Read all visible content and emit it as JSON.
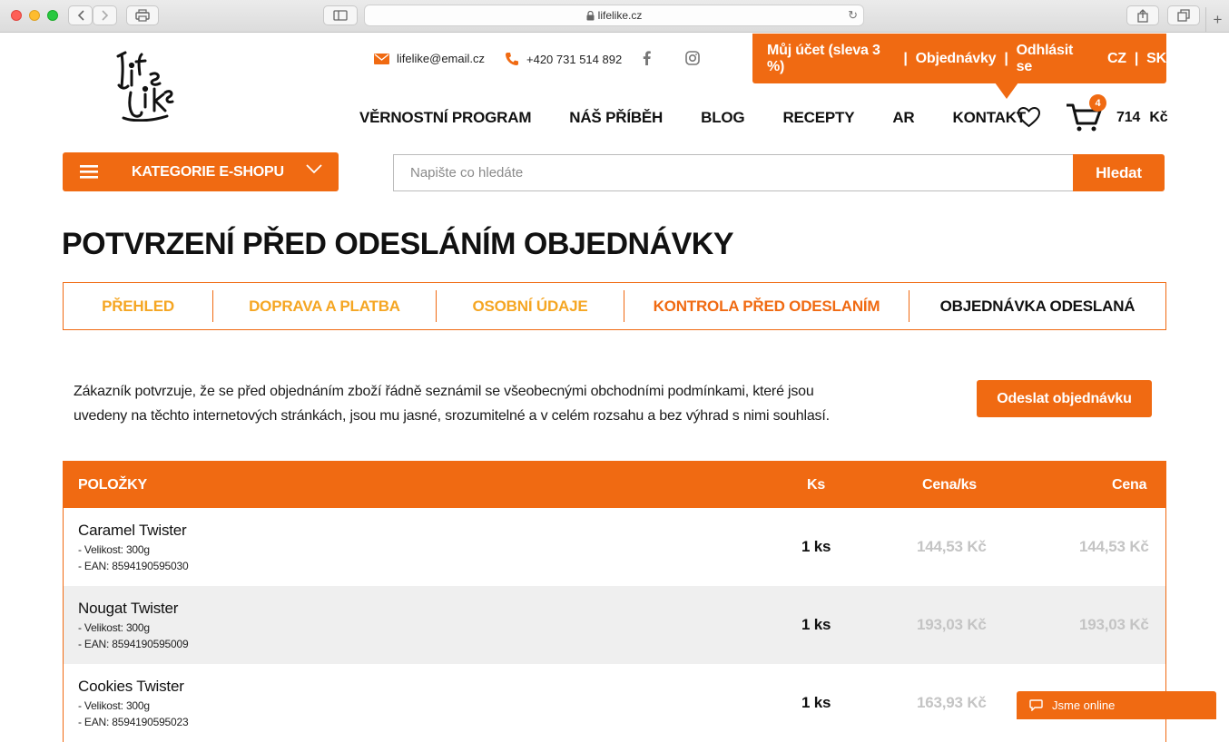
{
  "browser": {
    "url": "lifelike.cz"
  },
  "header": {
    "logo_text": "LiFeLiKe",
    "email": "lifelike@email.cz",
    "phone": "+420 731 514 892",
    "account": {
      "my_account": "Můj účet (sleva 3 %)",
      "orders": "Objednávky",
      "logout": "Odhlásit se",
      "lang_cz": "CZ",
      "lang_sk": "SK",
      "separator": "|"
    },
    "nav": [
      "VĚRNOSTNÍ PROGRAM",
      "NÁŠ PŘÍBĚH",
      "BLOG",
      "RECEPTY",
      "AR",
      "KONTAKT"
    ],
    "cart": {
      "count": "4",
      "total": "714",
      "currency": "Kč"
    },
    "category_button": "KATEGORIE E-SHOPU",
    "search": {
      "placeholder": "Napište co hledáte",
      "button": "Hledat"
    }
  },
  "page": {
    "title": "POTVRZENÍ PŘED ODESLÁNÍM OBJEDNÁVKY",
    "steps": [
      {
        "label": "PŘEHLED",
        "color": "#f5a623"
      },
      {
        "label": "DOPRAVA A PLATBA",
        "color": "#f5a623"
      },
      {
        "label": "OSOBNÍ ÚDAJE",
        "color": "#f5a623"
      },
      {
        "label": "KONTROLA PŘED ODESLANÍM",
        "color": "#f06a12"
      },
      {
        "label": "OBJEDNÁVKA ODESLANÁ",
        "color": "#111111"
      }
    ],
    "confirm_text_line1": "Zákazník potvrzuje, že se před objednáním zboží řádně seznámil se všeobecnými obchodními podmínkami, které jsou",
    "confirm_text_line2": "uvedeny na těchto internetových stránkách, jsou mu jasné, srozumitelné a v celém rozsahu a bez výhrad s nimi souhlasí.",
    "send_button": "Odeslat objednávku"
  },
  "table": {
    "headers": {
      "items": "POLOŽKY",
      "qty": "Ks",
      "unit_price": "Cena/ks",
      "price": "Cena"
    },
    "rows": [
      {
        "name": "Caramel Twister",
        "size": "- Velikost: 300g",
        "ean": "- EAN: 8594190595030",
        "qty": "1 ks",
        "unit_price": "144,53 Kč",
        "price": "144,53 Kč"
      },
      {
        "name": "Nougat Twister",
        "size": "- Velikost: 300g",
        "ean": "- EAN: 8594190595009",
        "qty": "1 ks",
        "unit_price": "193,03 Kč",
        "price": "193,03 Kč"
      },
      {
        "name": "Cookies Twister",
        "size": "- Velikost: 300g",
        "ean": "- EAN: 8594190595023",
        "qty": "1 ks",
        "unit_price": "163,93 Kč",
        "price": ""
      }
    ]
  },
  "chat": {
    "label": "Jsme online"
  },
  "colors": {
    "accent": "#f06a12"
  }
}
